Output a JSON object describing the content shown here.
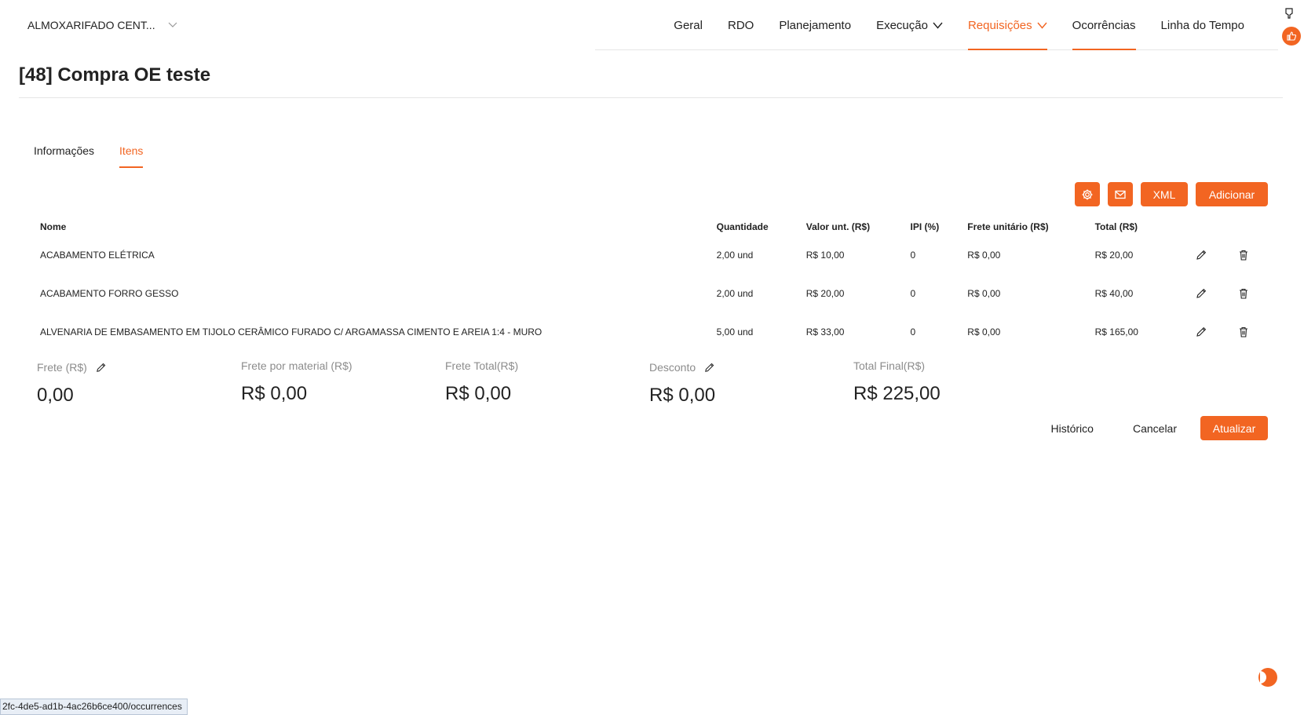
{
  "header": {
    "project": "ALMOXARIFADO CENT...",
    "nav": [
      {
        "label": "Geral"
      },
      {
        "label": "RDO"
      },
      {
        "label": "Planejamento"
      },
      {
        "label": "Execução"
      },
      {
        "label": "Requisições"
      },
      {
        "label": "Ocorrências"
      },
      {
        "label": "Linha do Tempo"
      }
    ]
  },
  "page": {
    "title": "[48] Compra OE teste"
  },
  "tabs": [
    {
      "label": "Informações"
    },
    {
      "label": "Itens"
    }
  ],
  "toolbar": {
    "xml_label": "XML",
    "add_label": "Adicionar"
  },
  "table": {
    "headers": {
      "name": "Nome",
      "qty": "Quantidade",
      "unit_value": "Valor unt. (R$)",
      "ipi": "IPI (%)",
      "unit_freight": "Frete unitário (R$)",
      "total": "Total (R$)"
    },
    "rows": [
      {
        "name": "ACABAMENTO ELÉTRICA",
        "qty": "2,00 und",
        "unit_value": "R$ 10,00",
        "ipi": "0",
        "unit_freight": "R$ 0,00",
        "total": "R$ 20,00"
      },
      {
        "name": "ACABAMENTO FORRO GESSO",
        "qty": "2,00 und",
        "unit_value": "R$ 20,00",
        "ipi": "0",
        "unit_freight": "R$ 0,00",
        "total": "R$ 40,00"
      },
      {
        "name": "ALVENARIA DE EMBASAMENTO EM TIJOLO CERÂMICO FURADO C/ ARGAMASSA CIMENTO E AREIA 1:4 - MURO",
        "qty": "5,00 und",
        "unit_value": "R$ 33,00",
        "ipi": "0",
        "unit_freight": "R$ 0,00",
        "total": "R$ 165,00"
      }
    ]
  },
  "summary": {
    "freight_label": "Frete (R$)",
    "freight_value": "0,00",
    "freight_per_material_label": "Frete por material (R$)",
    "freight_per_material_value": "R$ 0,00",
    "freight_total_label": "Frete Total(R$)",
    "freight_total_value": "R$ 0,00",
    "discount_label": "Desconto",
    "discount_value": "R$ 0,00",
    "total_final_label": "Total Final(R$)",
    "total_final_value": "R$ 225,00"
  },
  "actions": {
    "history_label": "Histórico",
    "cancel_label": "Cancelar",
    "update_label": "Atualizar"
  },
  "statusbar": {
    "url": "2fc-4de5-ad1b-4ac26b6ce400/occurrences"
  },
  "colors": {
    "accent": "#f26522"
  }
}
